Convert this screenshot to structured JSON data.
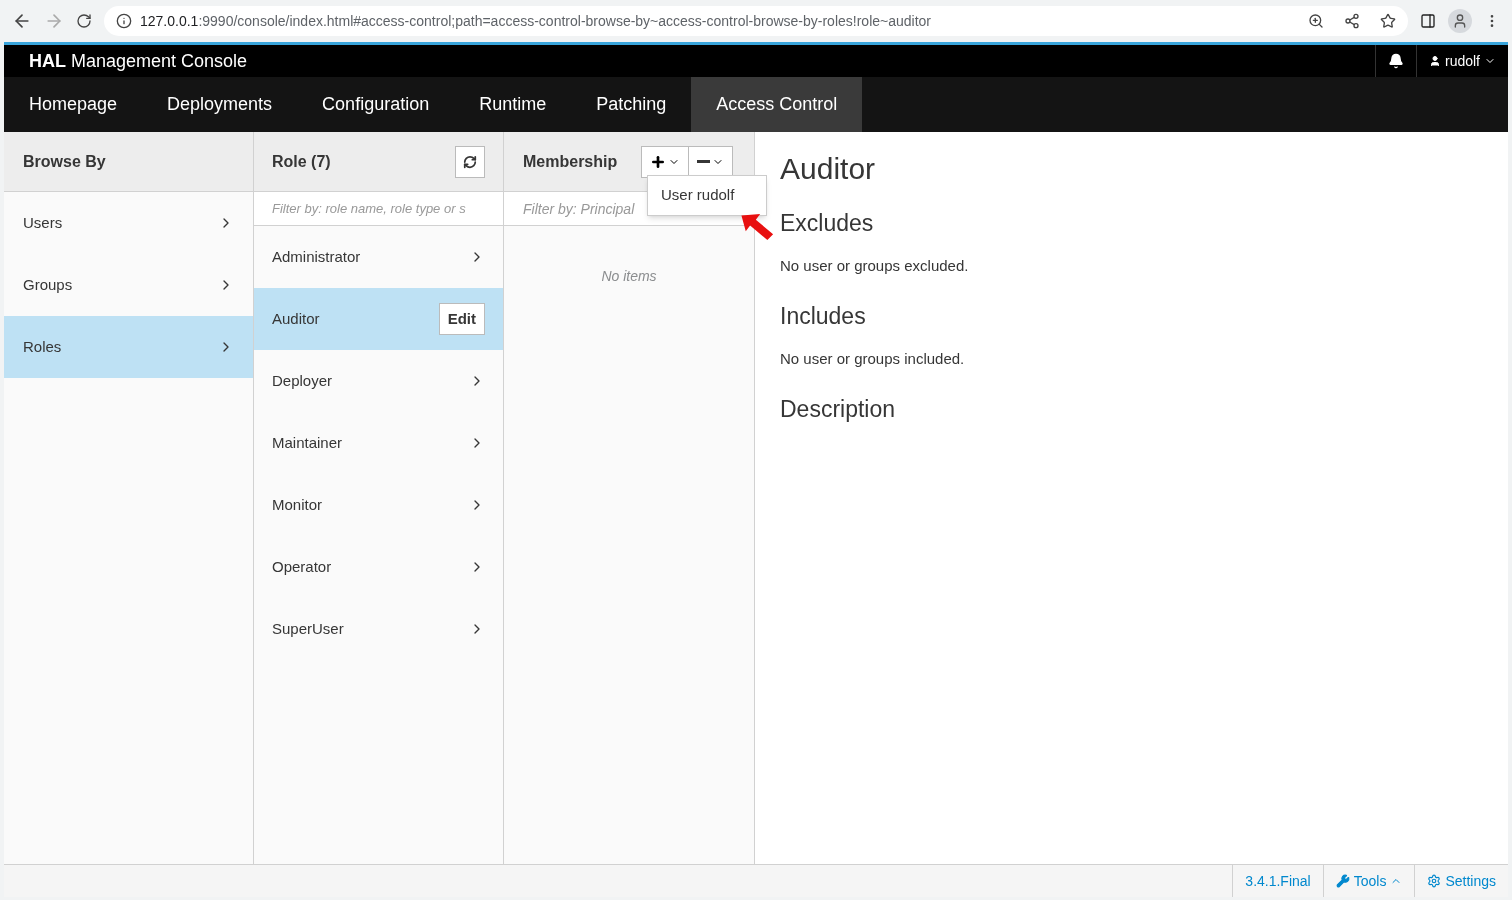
{
  "browser": {
    "url_host": "127.0.0.1",
    "url_rest": ":9990/console/index.html#access-control;path=access-control-browse-by~access-control-browse-by-roles!role~auditor"
  },
  "header": {
    "brand_bold": "HAL",
    "brand_rest": "Management Console",
    "user": "rudolf"
  },
  "nav": [
    {
      "label": "Homepage",
      "selected": false
    },
    {
      "label": "Deployments",
      "selected": false
    },
    {
      "label": "Configuration",
      "selected": false
    },
    {
      "label": "Runtime",
      "selected": false
    },
    {
      "label": "Patching",
      "selected": false
    },
    {
      "label": "Access Control",
      "selected": true
    }
  ],
  "browse_by": {
    "title": "Browse By",
    "items": [
      {
        "label": "Users",
        "selected": false
      },
      {
        "label": "Groups",
        "selected": false
      },
      {
        "label": "Roles",
        "selected": true
      }
    ]
  },
  "roles": {
    "title": "Role (7)",
    "filter_placeholder": "Filter by: role name, role type or s",
    "items": [
      {
        "label": "Administrator",
        "selected": false
      },
      {
        "label": "Auditor",
        "selected": true
      },
      {
        "label": "Deployer",
        "selected": false
      },
      {
        "label": "Maintainer",
        "selected": false
      },
      {
        "label": "Monitor",
        "selected": false
      },
      {
        "label": "Operator",
        "selected": false
      },
      {
        "label": "SuperUser",
        "selected": false
      }
    ],
    "edit": "Edit"
  },
  "membership": {
    "title": "Membership",
    "filter_placeholder": "Filter by: Principal",
    "empty": "No items",
    "menu": [
      "User rudolf"
    ]
  },
  "detail": {
    "title": "Auditor",
    "sections": [
      {
        "heading": "Excludes",
        "text": "No user or groups excluded."
      },
      {
        "heading": "Includes",
        "text": "No user or groups included."
      },
      {
        "heading": "Description"
      }
    ]
  },
  "footer": {
    "version": "3.4.1.Final",
    "tools": "Tools",
    "settings": "Settings"
  }
}
